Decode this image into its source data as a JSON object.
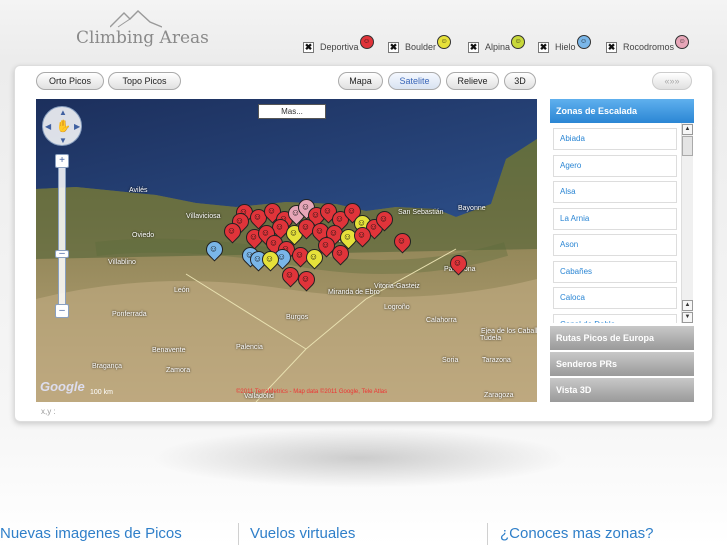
{
  "header": {
    "logo_text": "Climbing Areas",
    "filters": [
      {
        "label": "Deportiva",
        "checked": true,
        "color": "#e0343a"
      },
      {
        "label": "Boulder",
        "checked": true,
        "color": "#e6e13a"
      },
      {
        "label": "Alpina",
        "checked": true,
        "color": "#c8d83a"
      },
      {
        "label": "Hielo",
        "checked": true,
        "color": "#7ab6e8"
      },
      {
        "label": "Rocodromos",
        "checked": true,
        "color": "#e7a6b8"
      }
    ]
  },
  "toolbar": {
    "orto_picos": "Orto Picos",
    "topo_picos": "Topo Picos",
    "mapa": "Mapa",
    "satelite": "Satelite",
    "relieve": "Relieve",
    "three_d": "3D",
    "nav": "«»»"
  },
  "map": {
    "mas_label": "Mas...",
    "google": "Google",
    "scale_label": "100 km",
    "copyright": "©2011 TerraMetrics - Map data ©2011 Google, Tele Atlas",
    "places": [
      {
        "name": "Avilés"
      },
      {
        "name": "Oviedo"
      },
      {
        "name": "Villaviciosa"
      },
      {
        "name": "San Sebastián"
      },
      {
        "name": "Bayonne"
      },
      {
        "name": "Bilbao"
      },
      {
        "name": "Pamplona"
      },
      {
        "name": "Vitoria-Gasteiz"
      },
      {
        "name": "León"
      },
      {
        "name": "Ponferrada"
      },
      {
        "name": "Burgos"
      },
      {
        "name": "Logroño"
      },
      {
        "name": "Palencia"
      },
      {
        "name": "Valladolid"
      },
      {
        "name": "Zamora"
      },
      {
        "name": "Bragança"
      },
      {
        "name": "Benavente"
      },
      {
        "name": "Villablino"
      },
      {
        "name": "Miranda de Ebro"
      },
      {
        "name": "Calahorra"
      },
      {
        "name": "Soria"
      },
      {
        "name": "Tarazona"
      },
      {
        "name": "Tudela"
      },
      {
        "name": "Ejea de los Caballeros"
      },
      {
        "name": "Zaragoza"
      }
    ]
  },
  "coords": "x,y :",
  "sidebar": {
    "zonas_header": "Zonas de Escalada",
    "zones": [
      "Abiada",
      "Agero",
      "Alsa",
      "La Arnia",
      "Ason",
      "Cabañes",
      "Caloca",
      "Canal de Dobla"
    ],
    "rutas_header": "Rutas Picos de Europa",
    "senderos_header": "Senderos PRs",
    "vista_header": "Vista 3D"
  },
  "bottom": {
    "col1": "Nuevas imagenes de Picos",
    "col2": "Vuelos virtuales",
    "col3": "¿Conoces mas zonas?"
  }
}
